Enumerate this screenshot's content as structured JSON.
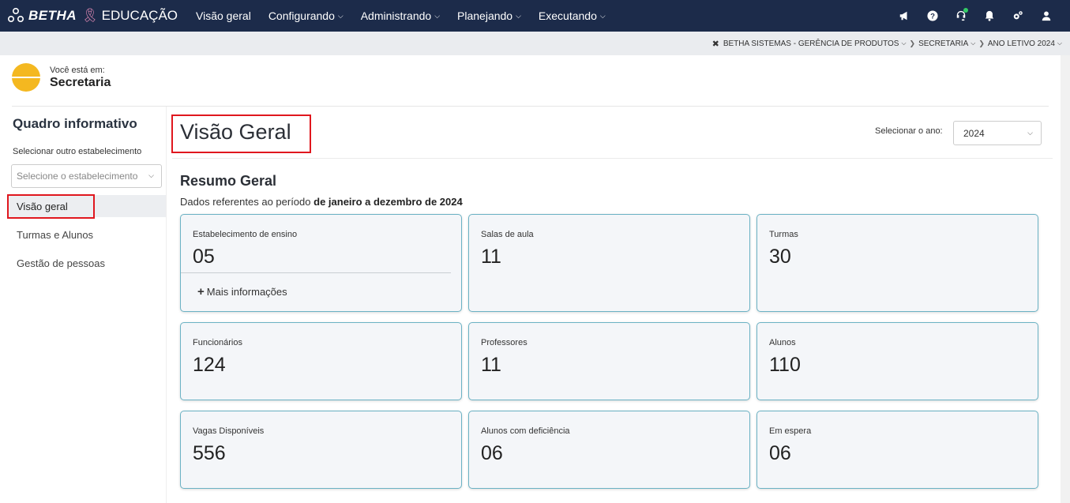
{
  "brand": {
    "name": "BETHA",
    "product": "EDUCAÇÃO"
  },
  "nav": [
    {
      "label": "Visão geral",
      "has_menu": false
    },
    {
      "label": "Configurando",
      "has_menu": true
    },
    {
      "label": "Administrando",
      "has_menu": true
    },
    {
      "label": "Planejando",
      "has_menu": true
    },
    {
      "label": "Executando",
      "has_menu": true
    }
  ],
  "top_icons": [
    "megaphone-icon",
    "help-icon",
    "headset-icon",
    "bell-icon",
    "gears-icon",
    "user-icon"
  ],
  "context": {
    "entity": "BETHA SISTEMAS - GERÊNCIA DE PRODUTOS",
    "unit": "SECRETARIA",
    "year": "ANO LETIVO 2024"
  },
  "location": {
    "label": "Você está em:",
    "name": "Secretaria"
  },
  "sidebar": {
    "title": "Quadro informativo",
    "select_label": "Selecionar outro estabelecimento",
    "select_placeholder": "Selecione o estabelecimento",
    "items": [
      {
        "label": "Visão geral",
        "active": true
      },
      {
        "label": "Turmas e Alunos",
        "active": false
      },
      {
        "label": "Gestão de pessoas",
        "active": false
      }
    ]
  },
  "main": {
    "title": "Visão Geral",
    "year_label": "Selecionar o ano:",
    "year_value": "2024",
    "section_title": "Resumo Geral",
    "period_prefix": "Dados referentes ao período",
    "period_range": "de janeiro a dezembro de 2024",
    "more_info": "Mais informações",
    "cards": [
      {
        "label": "Estabelecimento de ensino",
        "value": "05"
      },
      {
        "label": "Salas de aula",
        "value": "11"
      },
      {
        "label": "Turmas",
        "value": "30"
      },
      {
        "label": "Funcionários",
        "value": "124"
      },
      {
        "label": "Professores",
        "value": "11"
      },
      {
        "label": "Alunos",
        "value": "110"
      },
      {
        "label": "Vagas Disponíveis",
        "value": "556"
      },
      {
        "label": "Alunos com deficiência",
        "value": "06"
      },
      {
        "label": "Em espera",
        "value": "06"
      }
    ]
  },
  "colors": {
    "topbar": "#1c2b4a",
    "accent": "#6bb2c4",
    "highlight": "#e0171e",
    "avatar": "#f4b820"
  }
}
